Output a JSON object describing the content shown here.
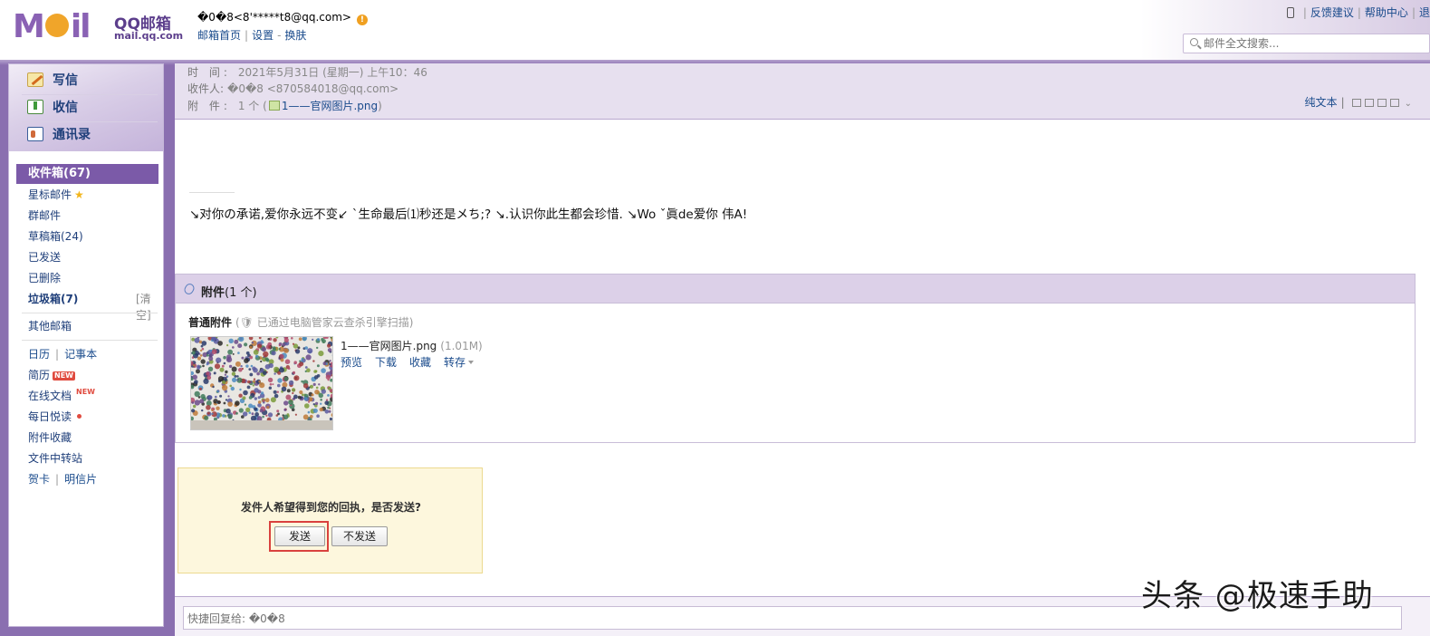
{
  "header": {
    "logo_text": "MOil",
    "logo_name": "QQ邮箱",
    "logo_domain": "mail.qq.com",
    "account": "�0�8<8'*****t8@qq.com>",
    "links": {
      "home": "邮箱首页",
      "settings": "设置",
      "dash": "-",
      "skin": "换肤"
    },
    "top_links": {
      "feedback": "反馈建议",
      "help": "帮助中心",
      "logout": "退"
    },
    "search": {
      "placeholder": "邮件全文搜索..."
    }
  },
  "sidebar": {
    "quick": {
      "compose": "写信",
      "inbox": "收信",
      "contacts": "通讯录"
    },
    "folders": {
      "inbox": "收件箱(67)",
      "starred": "星标邮件",
      "group": "群邮件",
      "drafts": "草稿箱(24)",
      "sent": "已发送",
      "deleted": "已删除",
      "spam": "垃圾箱(7)",
      "spam_clear": "[清空]",
      "other": "其他邮箱",
      "calendar": "日历",
      "notes": "记事本",
      "resume": "简历",
      "resume_badge": "NEW",
      "docs": "在线文档",
      "docs_badge": "NEW",
      "daily": "每日悦读",
      "att_fav": "附件收藏",
      "file_transfer": "文件中转站",
      "cards": "贺卡",
      "postcards": "明信片"
    }
  },
  "mail": {
    "time_label": "时 间:",
    "time_value": "2021年5月31日 (星期一) 上午10：46",
    "to_label": "收件人:",
    "to_value": "�0�8 <870584018@qq.com>",
    "att_label": "附 件:",
    "att_value_prefix": "1 个 (",
    "att_value_file": "1——官网图片.png",
    "att_value_suffix": ")",
    "view_plain": "纯文本",
    "view_sep": "|",
    "body": "↘对你の承诺,爱你永远不变↙ `生命最后⑴秒还是メち;? ↘.认识你此生都会珍惜. ↘Wo ˇ眞de爱你 伟A!"
  },
  "attachments": {
    "title": "附件",
    "count": "(1 个)",
    "normal_label": "普通附件",
    "scan_note": "(🛡 已通过电脑管家云查杀引擎扫描)",
    "file": {
      "name": "1——官网图片.png",
      "size": "(1.01M)",
      "actions": {
        "preview": "预览",
        "download": "下载",
        "collect": "收藏",
        "save_to": "转存"
      }
    }
  },
  "receipt": {
    "message": "发件人希望得到您的回执，是否发送?",
    "send": "发送",
    "no_send": "不发送"
  },
  "reply": {
    "placeholder": "快捷回复给: �0�8"
  },
  "watermark": "头条 @极速手助",
  "colors": {
    "purple_frame": "#8a6fb0",
    "active_folder": "#7b5aa8",
    "link": "#1a4b8c",
    "highlight_red": "#d9413e"
  }
}
